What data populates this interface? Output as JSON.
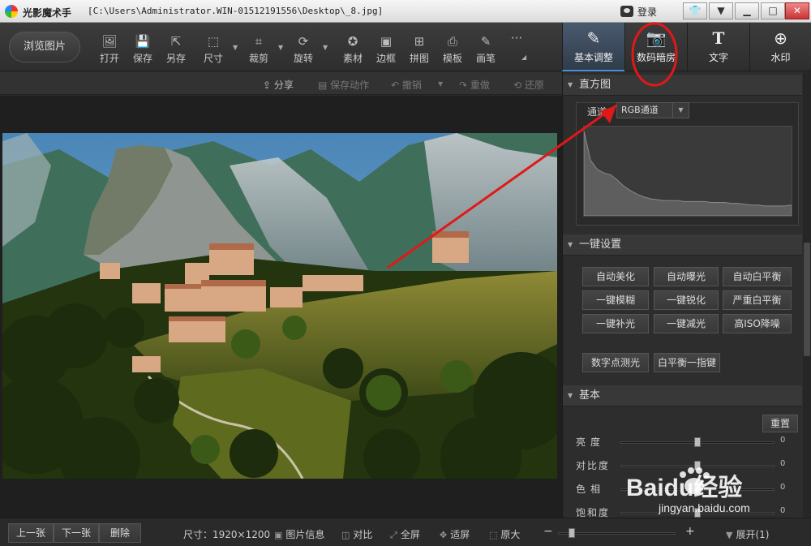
{
  "title_bar": {
    "app_title": "光影魔术手",
    "file_path": "[C:\\Users\\Administrator.WIN-01512191556\\Desktop\\_8.jpg]",
    "login_label": "登录"
  },
  "toolbar": {
    "browse_label": "浏览图片",
    "tools": [
      {
        "label": "打开",
        "icon": "open-icon"
      },
      {
        "label": "保存",
        "icon": "save-icon"
      },
      {
        "label": "另存",
        "icon": "save-as-icon"
      },
      {
        "label": "尺寸",
        "icon": "resize-icon"
      },
      {
        "label": "裁剪",
        "icon": "crop-icon"
      },
      {
        "label": "旋转",
        "icon": "rotate-icon"
      },
      {
        "label": "素材",
        "icon": "material-icon"
      },
      {
        "label": "边框",
        "icon": "border-icon"
      },
      {
        "label": "拼图",
        "icon": "collage-icon"
      },
      {
        "label": "模板",
        "icon": "template-icon"
      },
      {
        "label": "画笔",
        "icon": "brush-icon"
      }
    ],
    "more_glyph": "···"
  },
  "right_tabs": [
    {
      "label": "基本调整",
      "icon": "adjust-icon",
      "active": true
    },
    {
      "label": "数码暗房",
      "icon": "darkroom-icon",
      "active": false
    },
    {
      "label": "文字",
      "icon": "text-icon",
      "active": false
    },
    {
      "label": "水印",
      "icon": "watermark-icon",
      "active": false
    }
  ],
  "sub_toolbar": {
    "share": "分享",
    "save_action": "保存动作",
    "undo": "撤销",
    "redo": "重做",
    "restore": "还原"
  },
  "histogram": {
    "header": "直方图",
    "channel_label": "通道",
    "channel_value": "RGB通道",
    "levels": [
      0.95,
      0.62,
      0.52,
      0.48,
      0.46,
      0.4,
      0.33,
      0.28,
      0.24,
      0.21,
      0.19,
      0.18,
      0.17,
      0.17,
      0.17,
      0.16,
      0.16,
      0.16,
      0.16,
      0.15,
      0.15,
      0.15,
      0.14,
      0.14,
      0.13,
      0.12,
      0.12,
      0.11,
      0.11,
      0.11,
      0.11,
      0.12
    ]
  },
  "one_click": {
    "header": "一键设置",
    "buttons": [
      "自动美化",
      "自动曝光",
      "自动白平衡",
      "一键模糊",
      "一键锐化",
      "严重白平衡",
      "一键补光",
      "一键减光",
      "高ISO降噪"
    ],
    "extra_buttons": [
      "数字点测光",
      "白平衡一指键"
    ]
  },
  "basic": {
    "header": "基本",
    "reset_label": "重置",
    "sliders": [
      {
        "label": "亮度",
        "value": "0",
        "level": 0.5
      },
      {
        "label": "对比度",
        "value": "0",
        "level": 0.5
      },
      {
        "label": "色相",
        "value": "0",
        "level": 0.5
      },
      {
        "label": "饱和度",
        "value": "0",
        "level": 0.5
      }
    ]
  },
  "status_bar": {
    "prev": "上一张",
    "next": "下一张",
    "delete": "删除",
    "size_text": "尺寸：1920×1200",
    "info": "图片信息",
    "compare": "对比",
    "fullscreen": "全屏",
    "fit": "适屏",
    "original": "原大",
    "zoom_minus": "−",
    "zoom_plus": "+",
    "expand": "展开(1)"
  },
  "watermark": {
    "brand": "Baidu经验",
    "url": "jingyan.baidu.com"
  },
  "colors": {
    "annotation_red": "#e01818",
    "active_tab": "#4a90d9"
  }
}
